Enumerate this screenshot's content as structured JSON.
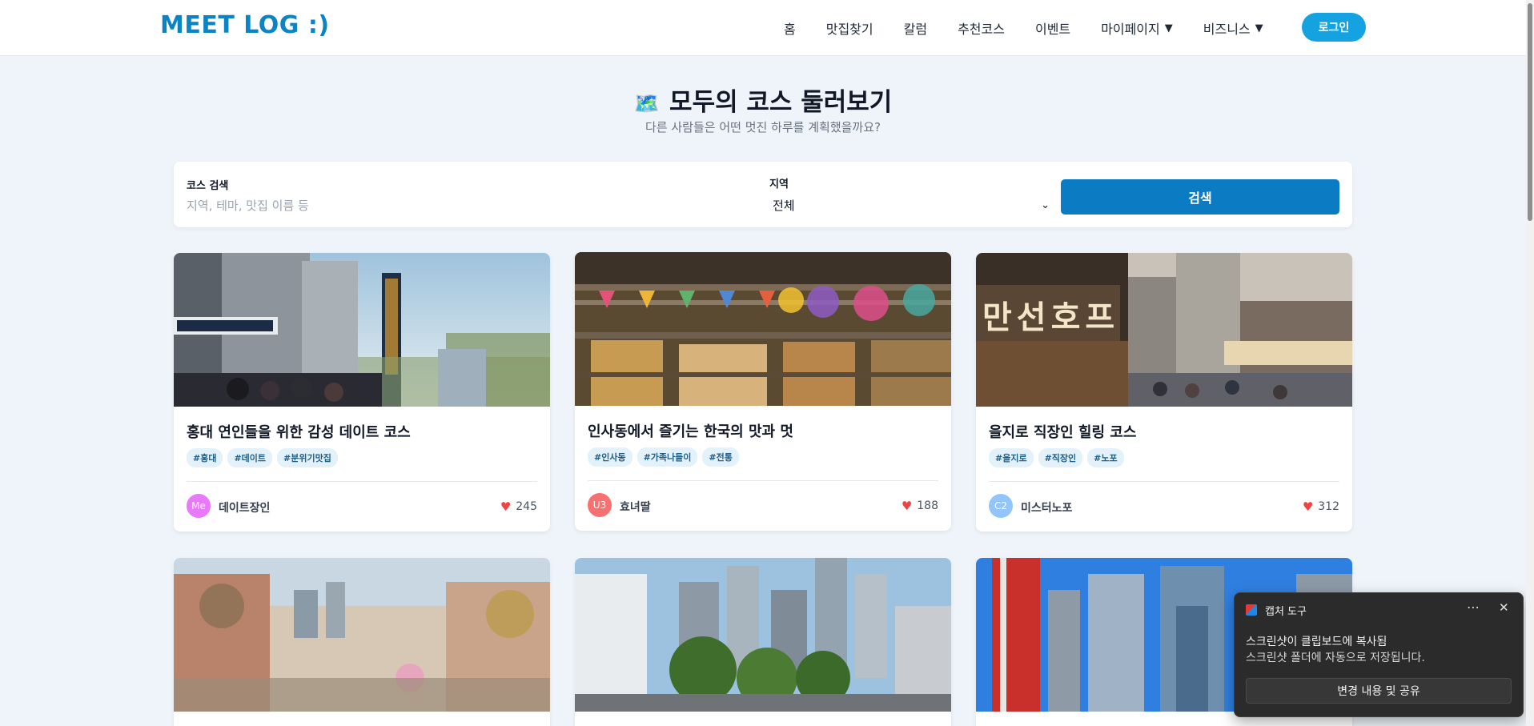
{
  "header": {
    "logo": "MEET LOG :)",
    "nav": [
      "홈",
      "맛집찾기",
      "칼럼",
      "추천코스",
      "이벤트"
    ],
    "nav_dropdowns": [
      "마이페이지",
      "비즈니스"
    ],
    "login": "로그인"
  },
  "page": {
    "title": "모두의 코스 둘러보기",
    "title_icon": "map-emoji",
    "subtitle": "다른 사람들은 어떤 멋진 하루를 계획했을까요?"
  },
  "search": {
    "label": "코스 검색",
    "placeholder": "지역, 테마, 맛집 이름 등",
    "region_label": "지역",
    "region_value": "전체",
    "button": "검색"
  },
  "cards": [
    {
      "title": "홍대 연인들을 위한 감성 데이트 코스",
      "tags": [
        "#홍대",
        "#데이트",
        "#분위기맛집"
      ],
      "avatar": "Me",
      "avatar_color": "#e879f9",
      "author": "데이트장인",
      "likes": "245"
    },
    {
      "title": "인사동에서 즐기는 한국의 맛과 멋",
      "tags": [
        "#인사동",
        "#가족나들이",
        "#전통"
      ],
      "avatar": "U3",
      "avatar_color": "#f87171",
      "author": "효녀딸",
      "likes": "188"
    },
    {
      "title": "을지로 직장인 힐링 코스",
      "tags": [
        "#을지로",
        "#직장인",
        "#노포"
      ],
      "avatar": "C2",
      "avatar_color": "#93c5fd",
      "author": "미스터노포",
      "likes": "312"
    }
  ],
  "toast": {
    "app": "캡처 도구",
    "line1": "스크린샷이 클립보드에 복사됨",
    "line2": "스크린샷 폴더에 자동으로 저장됩니다.",
    "button": "변경 내용 및 공유"
  },
  "colors": {
    "brand": "#0b84c6",
    "search_button": "#0b7cc3",
    "heart": "#ef4444",
    "tag_bg": "#e3f1fa"
  }
}
